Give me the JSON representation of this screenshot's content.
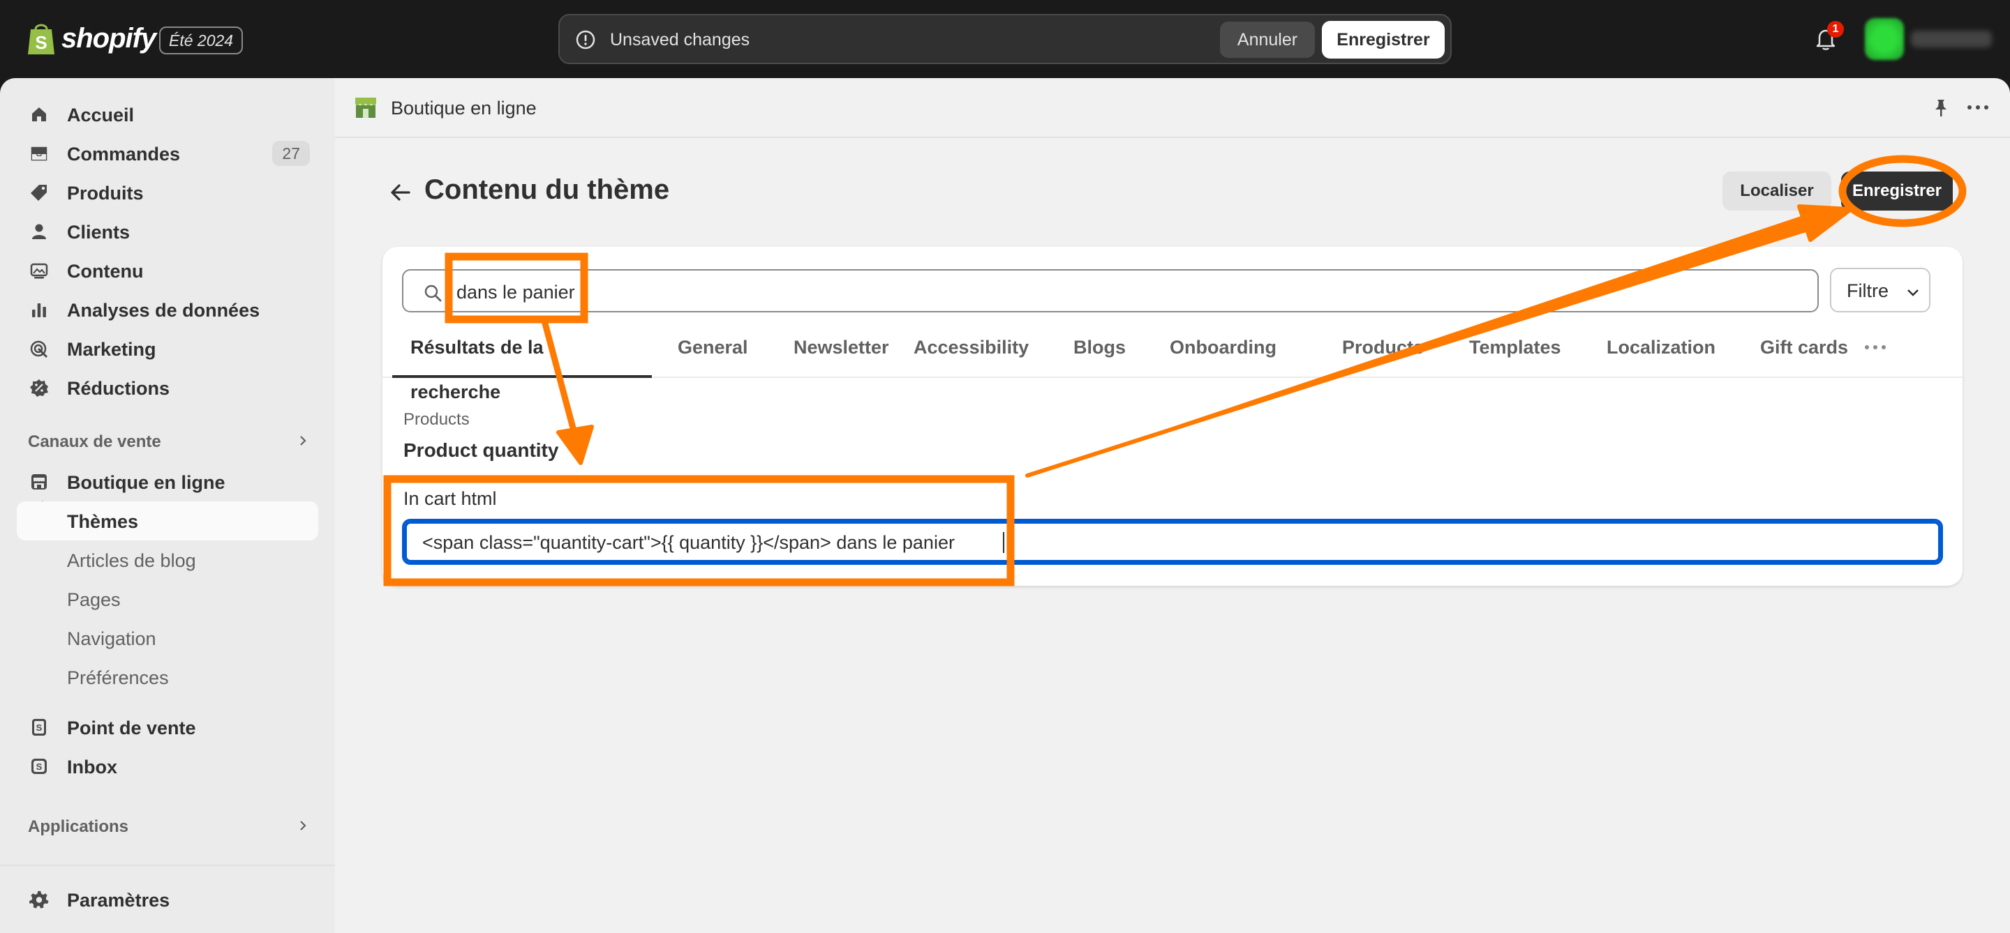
{
  "topbar": {
    "brand": "shopify",
    "edition": "Été 2024",
    "unsaved_text": "Unsaved changes",
    "cancel_label": "Annuler",
    "save_label": "Enregistrer",
    "notification_count": "1"
  },
  "sidebar": {
    "items": [
      {
        "label": "Accueil",
        "icon": "home-icon"
      },
      {
        "label": "Commandes",
        "icon": "inbox-icon",
        "count": "27"
      },
      {
        "label": "Produits",
        "icon": "tag-icon"
      },
      {
        "label": "Clients",
        "icon": "person-icon"
      },
      {
        "label": "Contenu",
        "icon": "content-icon"
      },
      {
        "label": "Analyses de données",
        "icon": "bar-chart-icon"
      },
      {
        "label": "Marketing",
        "icon": "target-icon"
      },
      {
        "label": "Réductions",
        "icon": "discount-icon"
      }
    ],
    "sales_channels_title": "Canaux de vente",
    "online_store": "Boutique en ligne",
    "sub_items": [
      "Thèmes",
      "Articles de blog",
      "Pages",
      "Navigation",
      "Préférences"
    ],
    "pos": "Point de vente",
    "inbox": "Inbox",
    "apps_title": "Applications",
    "settings": "Paramètres"
  },
  "main": {
    "store_title": "Boutique en ligne",
    "page_title": "Contenu du thème",
    "localize_label": "Localiser",
    "save_label": "Enregistrer",
    "search_value": "dans le panier",
    "filter_label": "Filtre",
    "tabs": [
      "Résultats de la recherche",
      "General",
      "Newsletter",
      "Accessibility",
      "Blogs",
      "Onboarding",
      "Products",
      "Templates",
      "Localization",
      "Gift cards"
    ],
    "group_label": "Products",
    "group_title": "Product quantity",
    "field_label": "In cart html",
    "field_value": "<span class=\"quantity-cart\">{{ quantity }}</span> dans le panier"
  },
  "colors": {
    "annotation": "#ff7a00",
    "focus": "#005bd3",
    "brand_green": "#95bf47"
  }
}
